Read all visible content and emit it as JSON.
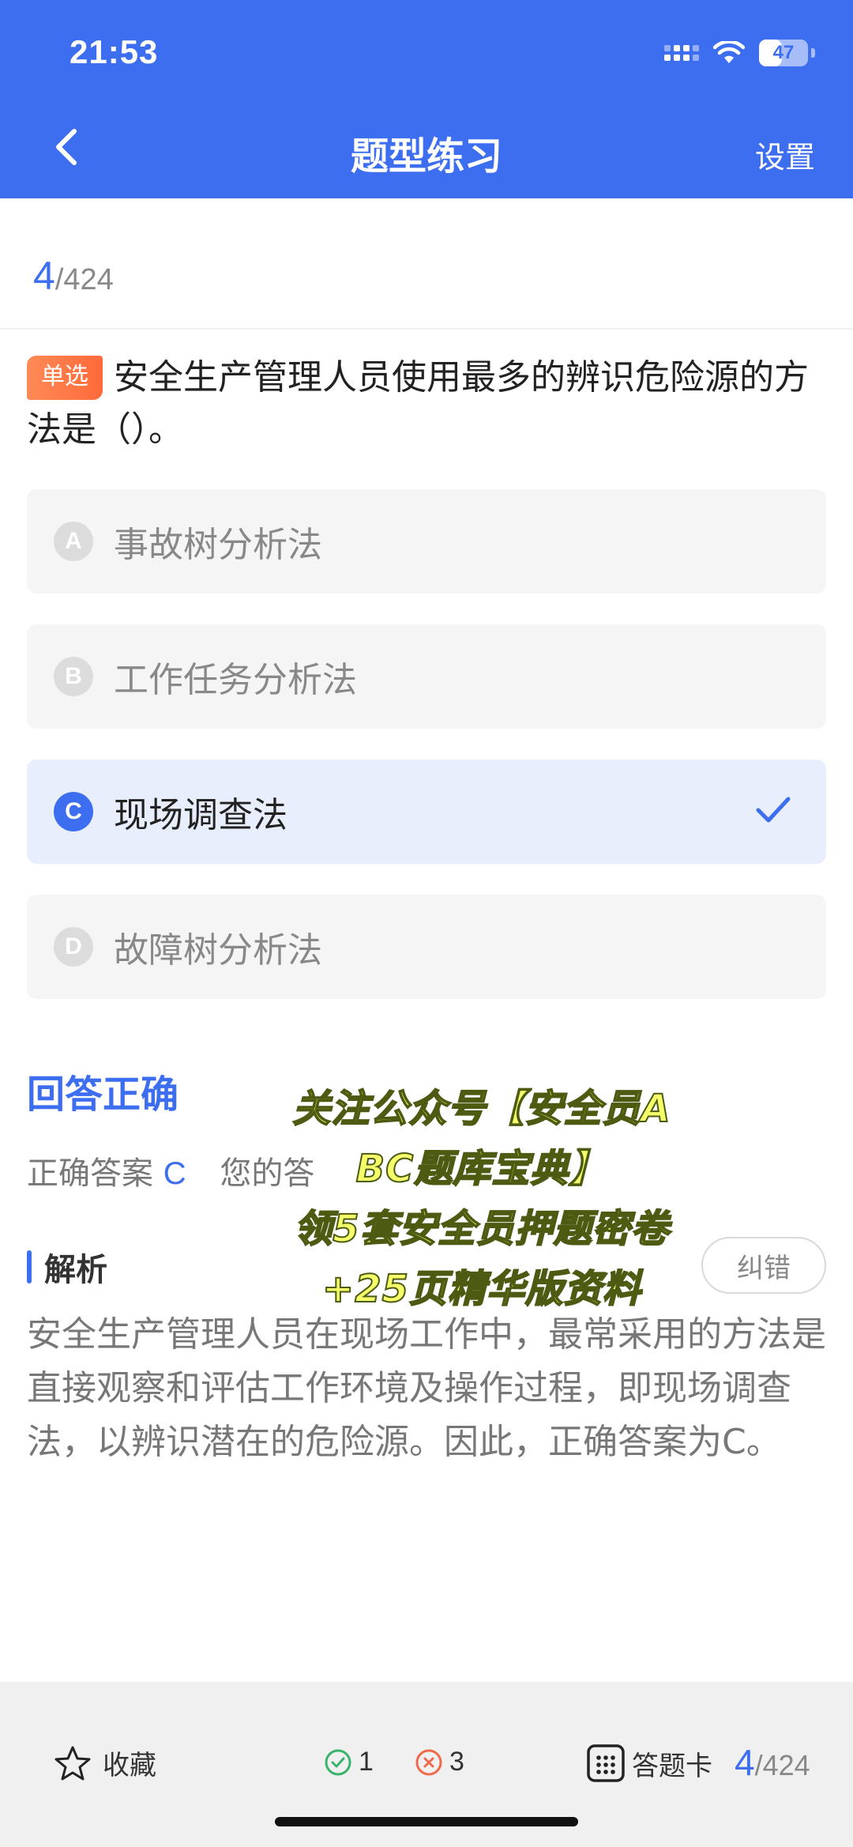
{
  "status_bar": {
    "time": "21:53",
    "battery": "47",
    "battery_level": 0.47
  },
  "nav": {
    "title": "题型练习",
    "settings_label": "设置"
  },
  "progress": {
    "current": "4",
    "total": "/424"
  },
  "question": {
    "type_label": "单选",
    "text": "安全生产管理人员使用最多的辨识危险源的方法是（）。"
  },
  "options": [
    {
      "letter": "A",
      "text": "事故树分析法",
      "state": "normal"
    },
    {
      "letter": "B",
      "text": "工作任务分析法",
      "state": "normal"
    },
    {
      "letter": "C",
      "text": "现场调查法",
      "state": "correct"
    },
    {
      "letter": "D",
      "text": "故障树分析法",
      "state": "normal"
    }
  ],
  "result": {
    "title": "回答正确",
    "correct_label": "正确答案",
    "correct_value": "C",
    "your_label": "您的答"
  },
  "analysis": {
    "heading": "解析",
    "report_label": "纠错",
    "body": "安全生产管理人员在现场工作中，最常采用的方法是直接观察和评估工作环境及操作过程，即现场调查法，以辨识潜在的危险源。因此，正确答案为C。"
  },
  "overlay": {
    "lines": [
      "关注公众号【安全员A",
      "BC题库宝典】",
      "领5套安全员押题密卷",
      "+25页精华版资料"
    ]
  },
  "bottom_bar": {
    "favorite_label": "收藏",
    "right_count": "1",
    "wrong_count": "3",
    "card_label": "答题卡",
    "current": "4",
    "total": "/424"
  },
  "colors": {
    "accent": "#3d6ef0",
    "tag": "#ff7a48",
    "right": "#39b36b",
    "wrong": "#f06a4a"
  }
}
